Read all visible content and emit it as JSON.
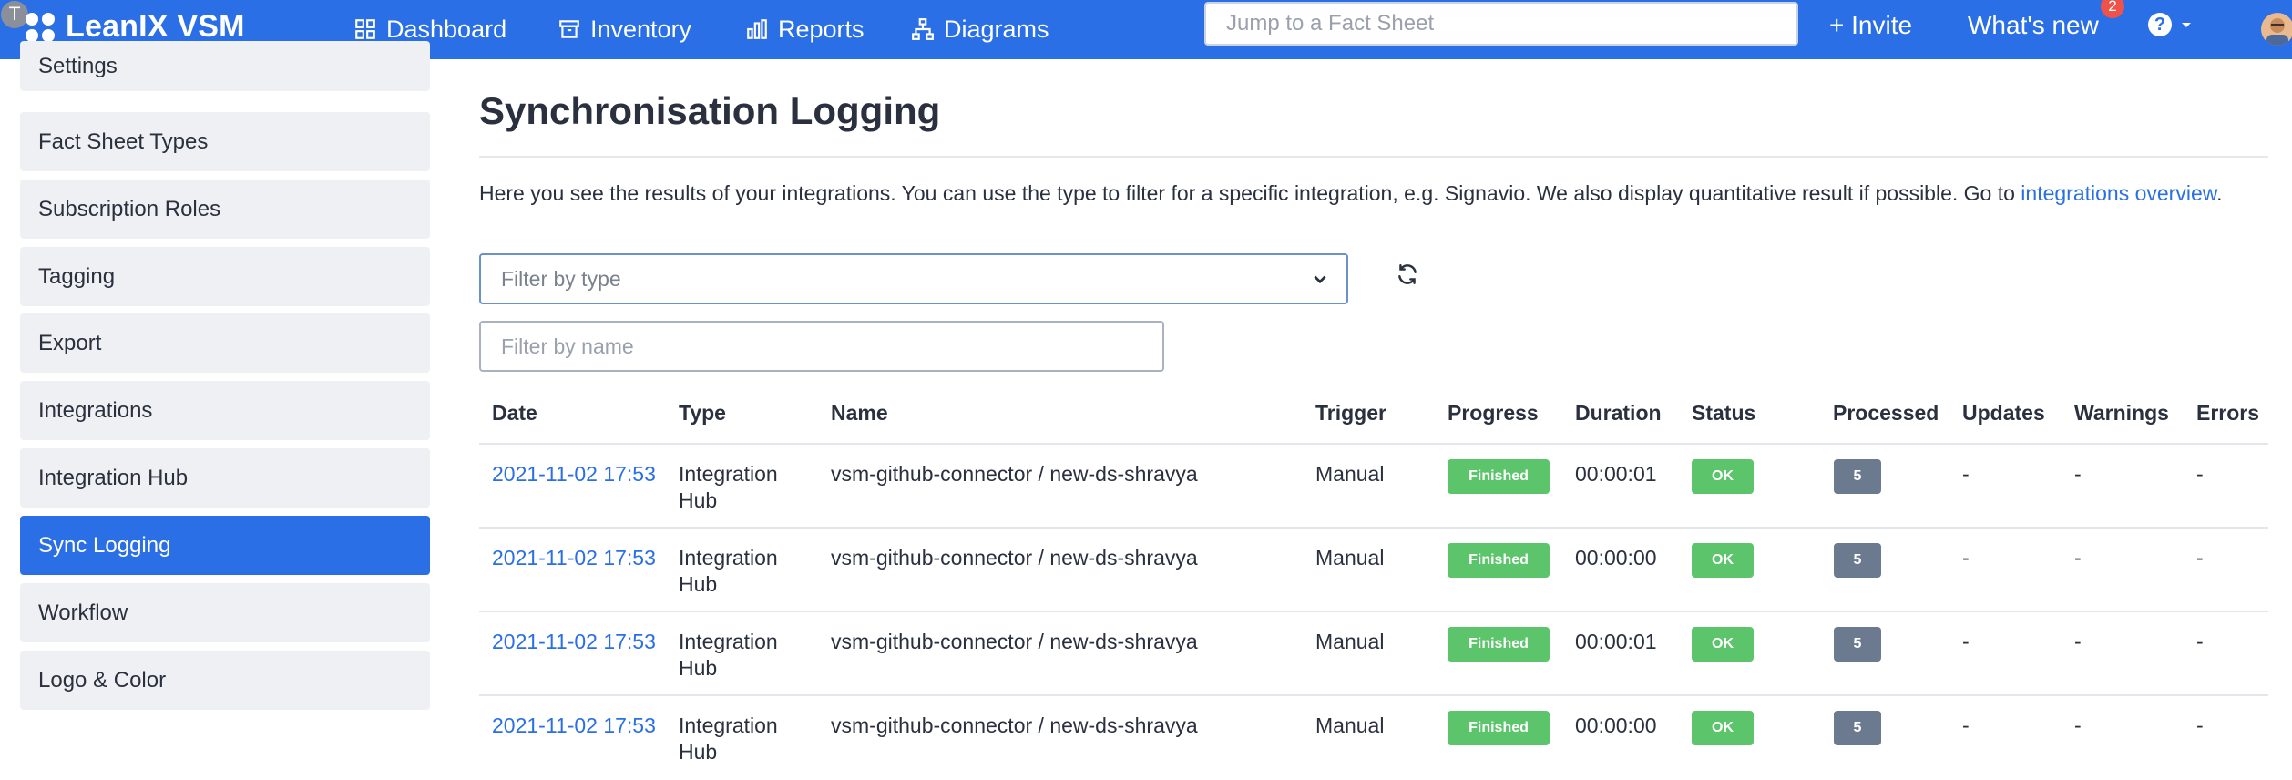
{
  "app": {
    "user_initial": "T",
    "brand": "LeanIX VSM"
  },
  "nav": [
    {
      "label": "Dashboard",
      "icon": "dashboard-icon"
    },
    {
      "label": "Inventory",
      "icon": "inventory-icon"
    },
    {
      "label": "Reports",
      "icon": "reports-icon"
    },
    {
      "label": "Diagrams",
      "icon": "diagrams-icon"
    }
  ],
  "search": {
    "placeholder": "Jump to a Fact Sheet"
  },
  "header_actions": {
    "invite": "+ Invite",
    "whats_new": "What's new",
    "whats_new_badge": "2"
  },
  "sidebar": {
    "items": [
      {
        "label": "Settings",
        "active": false
      },
      {
        "label": "Fact Sheet Types",
        "active": false
      },
      {
        "label": "Subscription Roles",
        "active": false
      },
      {
        "label": "Tagging",
        "active": false
      },
      {
        "label": "Export",
        "active": false
      },
      {
        "label": "Integrations",
        "active": false
      },
      {
        "label": "Integration Hub",
        "active": false
      },
      {
        "label": "Sync Logging",
        "active": true
      },
      {
        "label": "Workflow",
        "active": false
      },
      {
        "label": "Logo & Color",
        "active": false
      }
    ]
  },
  "main": {
    "title": "Synchronisation Logging",
    "intro_text": "Here you see the results of your integrations. You can use the type to filter for a specific integration, e.g. Signavio. We also display quantitative result if possible. Go to ",
    "intro_link": "integrations overview",
    "intro_end": ".",
    "filter_type_placeholder": "Filter by type",
    "filter_name_placeholder": "Filter by name"
  },
  "table": {
    "columns": [
      "Date",
      "Type",
      "Name",
      "Trigger",
      "Progress",
      "Duration",
      "Status",
      "Processed",
      "Updates",
      "Warnings",
      "Errors"
    ],
    "rows": [
      {
        "date": "2021-11-02 17:53",
        "type_line1": "Integration",
        "type_line2": "Hub",
        "name": "vsm-github-connector / new-ds-shravya",
        "trigger": "Manual",
        "progress": "Finished",
        "duration": "00:00:01",
        "status": "OK",
        "processed": "5",
        "updates": "-",
        "warnings": "-",
        "errors": "-"
      },
      {
        "date": "2021-11-02 17:53",
        "type_line1": "Integration",
        "type_line2": "Hub",
        "name": "vsm-github-connector / new-ds-shravya",
        "trigger": "Manual",
        "progress": "Finished",
        "duration": "00:00:00",
        "status": "OK",
        "processed": "5",
        "updates": "-",
        "warnings": "-",
        "errors": "-"
      },
      {
        "date": "2021-11-02 17:53",
        "type_line1": "Integration",
        "type_line2": "Hub",
        "name": "vsm-github-connector / new-ds-shravya",
        "trigger": "Manual",
        "progress": "Finished",
        "duration": "00:00:01",
        "status": "OK",
        "processed": "5",
        "updates": "-",
        "warnings": "-",
        "errors": "-"
      },
      {
        "date": "2021-11-02 17:53",
        "type_line1": "Integration",
        "type_line2": "Hub",
        "name": "vsm-github-connector / new-ds-shravya",
        "trigger": "Manual",
        "progress": "Finished",
        "duration": "00:00:00",
        "status": "OK",
        "processed": "5",
        "updates": "-",
        "warnings": "-",
        "errors": "-"
      }
    ]
  },
  "colors": {
    "brand_blue": "#2a6fe6",
    "success_green": "#5cc46b",
    "count_gray": "#6b7a8f",
    "sidebar_bg": "#eef0f3",
    "badge_red": "#f0524a"
  }
}
